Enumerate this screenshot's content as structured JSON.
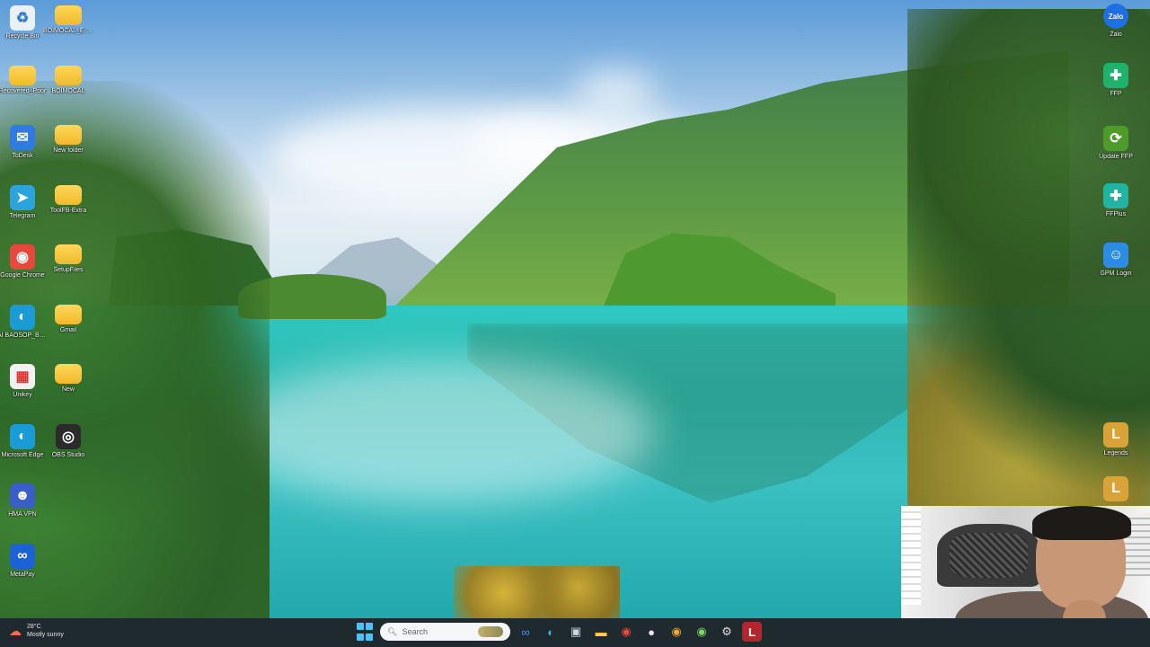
{
  "desktop": {
    "left_icons": [
      {
        "name": "recycle-bin",
        "label": "Recycle Bin",
        "glyph": "♻",
        "color": "#e9f1f7",
        "fg": "#2f7bd6"
      },
      {
        "name": "folder-1",
        "label": "BOIMOCAL_E-WEBOX",
        "glyph": "",
        "color": "folder"
      },
      {
        "name": "folder-2",
        "label": "Recovered_Poor",
        "glyph": "",
        "color": "folder"
      },
      {
        "name": "folder-3",
        "label": "BOIMOCAL",
        "glyph": "",
        "color": "folder"
      },
      {
        "name": "app-todesk",
        "label": "ToDesk",
        "glyph": "✉",
        "color": "#2d7be5"
      },
      {
        "name": "folder-4",
        "label": "New folder",
        "glyph": "",
        "color": "folder"
      },
      {
        "name": "telegram",
        "label": "Telegram",
        "glyph": "➤",
        "color": "#2aa3df"
      },
      {
        "name": "folder-5",
        "label": "ToolFB-Extra",
        "glyph": "",
        "color": "folder"
      },
      {
        "name": "google-chrome",
        "label": "Google Chrome",
        "glyph": "◉",
        "color": "#e9473b"
      },
      {
        "name": "folder-6",
        "label": "SetupFiles",
        "glyph": "",
        "color": "folder"
      },
      {
        "name": "edge",
        "label": "AI BAOSOP_BM_Manager",
        "glyph": "◐",
        "color": "#1a9bd7"
      },
      {
        "name": "folder-7",
        "label": "Gmail",
        "glyph": "",
        "color": "folder"
      },
      {
        "name": "app-red",
        "label": "Unikey",
        "glyph": "▦",
        "color": "#f1f1f1",
        "fg": "#d33"
      },
      {
        "name": "folder-8",
        "label": "New",
        "glyph": "",
        "color": "folder"
      },
      {
        "name": "microsoft-edge",
        "label": "Microsoft Edge",
        "glyph": "◐",
        "color": "#1a9bd7"
      },
      {
        "name": "obs-studio",
        "label": "OBS Studio",
        "glyph": "◎",
        "color": "#2b2b2b"
      },
      {
        "name": "app-person",
        "label": "HMA VPN",
        "glyph": "☻",
        "color": "#3a5ec7"
      },
      {
        "name": "meta",
        "label": "MetaPay",
        "glyph": "∞",
        "color": "#1b62d6"
      }
    ],
    "right_icons": [
      {
        "name": "zalo",
        "label": "Zalo",
        "glyph": "Zalo",
        "color": "#1e6fe3"
      },
      {
        "name": "ffp",
        "label": "FFP",
        "glyph": "✚",
        "color": "#1fb26d"
      },
      {
        "name": "update-ffp",
        "label": "Update FFP",
        "glyph": "⟳",
        "color": "#4d9c2a"
      },
      {
        "name": "ffp-plus",
        "label": "FFPlus",
        "glyph": "✚",
        "color": "#20b4a2"
      },
      {
        "name": "profile-manager",
        "label": "GPM Login",
        "glyph": "☺",
        "color": "#2b8be5"
      },
      {
        "name": "app-legends",
        "label": "Legends",
        "glyph": "L",
        "color": "#d9a338"
      },
      {
        "name": "app-legends-2",
        "label": "",
        "glyph": "L",
        "color": "#d9a338"
      }
    ]
  },
  "taskbar": {
    "weather_temp": "28°C",
    "weather_desc": "Mostly sunny",
    "search_placeholder": "Search",
    "apps": [
      {
        "name": "copilot",
        "glyph": "∞",
        "active": false,
        "fg": "#4c8cff"
      },
      {
        "name": "edge",
        "glyph": "◐",
        "active": false,
        "fg": "#2fb5e5"
      },
      {
        "name": "store",
        "glyph": "▣",
        "active": false,
        "fg": "#cfd8dc"
      },
      {
        "name": "file-explorer",
        "glyph": "▬",
        "active": false,
        "fg": "#ffcd45"
      },
      {
        "name": "chrome",
        "glyph": "◉",
        "active": false,
        "fg": "#e94b3c"
      },
      {
        "name": "chat",
        "glyph": "●",
        "active": false,
        "fg": "#e8e8e8"
      },
      {
        "name": "chrome-2",
        "glyph": "◉",
        "active": false,
        "fg": "#f0a830"
      },
      {
        "name": "chrome-3",
        "glyph": "◉",
        "active": false,
        "fg": "#7bd96a"
      },
      {
        "name": "settings",
        "glyph": "⚙",
        "active": false,
        "fg": "#dddddd"
      },
      {
        "name": "legends",
        "glyph": "L",
        "active": true,
        "fg": "#ffffff"
      }
    ]
  }
}
